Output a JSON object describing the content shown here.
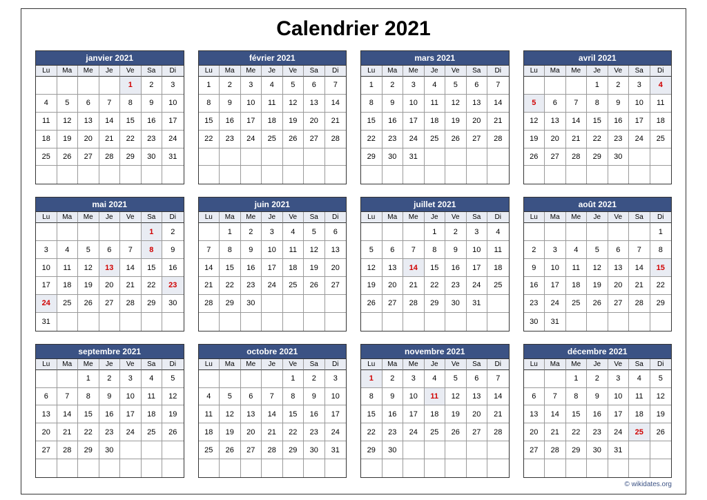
{
  "title": "Calendrier 2021",
  "weekdays": [
    "Lu",
    "Ma",
    "Me",
    "Je",
    "Ve",
    "Sa",
    "Di"
  ],
  "credit": "© wikidates.org",
  "months": [
    {
      "name": "janvier 2021",
      "firstDow": 4,
      "numDays": 31,
      "holidays": [
        1
      ]
    },
    {
      "name": "février 2021",
      "firstDow": 0,
      "numDays": 28,
      "holidays": []
    },
    {
      "name": "mars 2021",
      "firstDow": 0,
      "numDays": 31,
      "holidays": []
    },
    {
      "name": "avril 2021",
      "firstDow": 3,
      "numDays": 30,
      "holidays": [
        4,
        5
      ]
    },
    {
      "name": "mai 2021",
      "firstDow": 5,
      "numDays": 31,
      "holidays": [
        1,
        8,
        13,
        23,
        24
      ]
    },
    {
      "name": "juin 2021",
      "firstDow": 1,
      "numDays": 30,
      "holidays": []
    },
    {
      "name": "juillet 2021",
      "firstDow": 3,
      "numDays": 31,
      "holidays": [
        14
      ]
    },
    {
      "name": "août 2021",
      "firstDow": 6,
      "numDays": 31,
      "holidays": [
        15
      ]
    },
    {
      "name": "septembre 2021",
      "firstDow": 2,
      "numDays": 30,
      "holidays": []
    },
    {
      "name": "octobre 2021",
      "firstDow": 4,
      "numDays": 31,
      "holidays": []
    },
    {
      "name": "novembre 2021",
      "firstDow": 0,
      "numDays": 30,
      "holidays": [
        1,
        11
      ]
    },
    {
      "name": "décembre 2021",
      "firstDow": 2,
      "numDays": 31,
      "holidays": [
        25
      ]
    }
  ]
}
